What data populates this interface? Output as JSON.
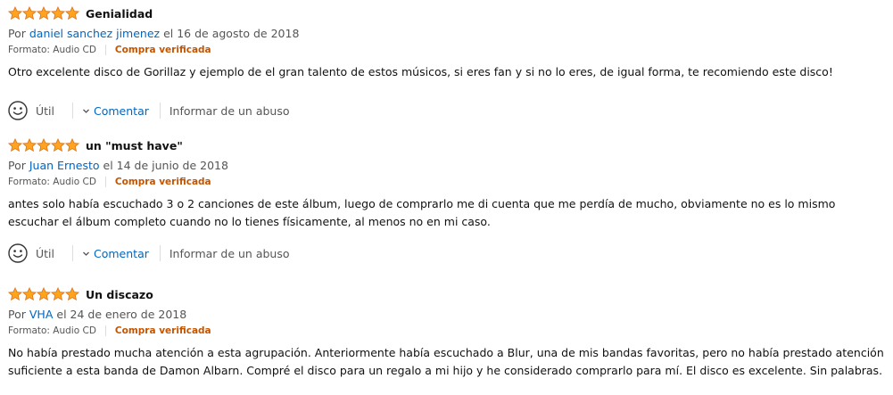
{
  "reviews": [
    {
      "rating": 5,
      "title": "Genialidad",
      "by_prefix": "Por",
      "author": "daniel sanchez jimenez",
      "date": "el 16 de agosto de 2018",
      "format": "Formato: Audio CD",
      "verified": "Compra verificada",
      "body": "Otro excelente disco de Gorillaz y ejemplo de el gran talento de estos músicos, si eres fan y si no lo eres, de igual forma, te recomiendo este disco!",
      "helpful_label": "Útil",
      "comment_label": "Comentar",
      "report_label": "Informar de un abuso"
    },
    {
      "rating": 5,
      "title": "un \"must have\"",
      "by_prefix": "Por",
      "author": "Juan Ernesto",
      "date": "el 14 de junio de 2018",
      "format": "Formato: Audio CD",
      "verified": "Compra verificada",
      "body": "antes solo había escuchado 3 o 2 canciones de este álbum, luego de comprarlo me di cuenta que me perdía de mucho, obviamente no es lo mismo escuchar el álbum completo cuando no lo tienes físicamente, al menos no en mi caso.",
      "helpful_label": "Útil",
      "comment_label": "Comentar",
      "report_label": "Informar de un abuso"
    },
    {
      "rating": 5,
      "title": "Un discazo",
      "by_prefix": "Por",
      "author": "VHA",
      "date": "el 24 de enero de 2018",
      "format": "Formato: Audio CD",
      "verified": "Compra verificada",
      "body": "No había prestado mucha atención a esta agrupación. Anteriormente había escuchado a Blur, una de mis bandas favoritas, pero no había prestado atención suficiente a esta banda de Damon Albarn. Compré el disco para un regalo a mi hijo y he considerado comprarlo para mí. El disco es excelente. Sin palabras."
    }
  ],
  "colors": {
    "star_fill": "#ffa41c",
    "star_stroke": "#de7921",
    "link": "#0066c0",
    "verified": "#c45500",
    "muted": "#555555"
  }
}
